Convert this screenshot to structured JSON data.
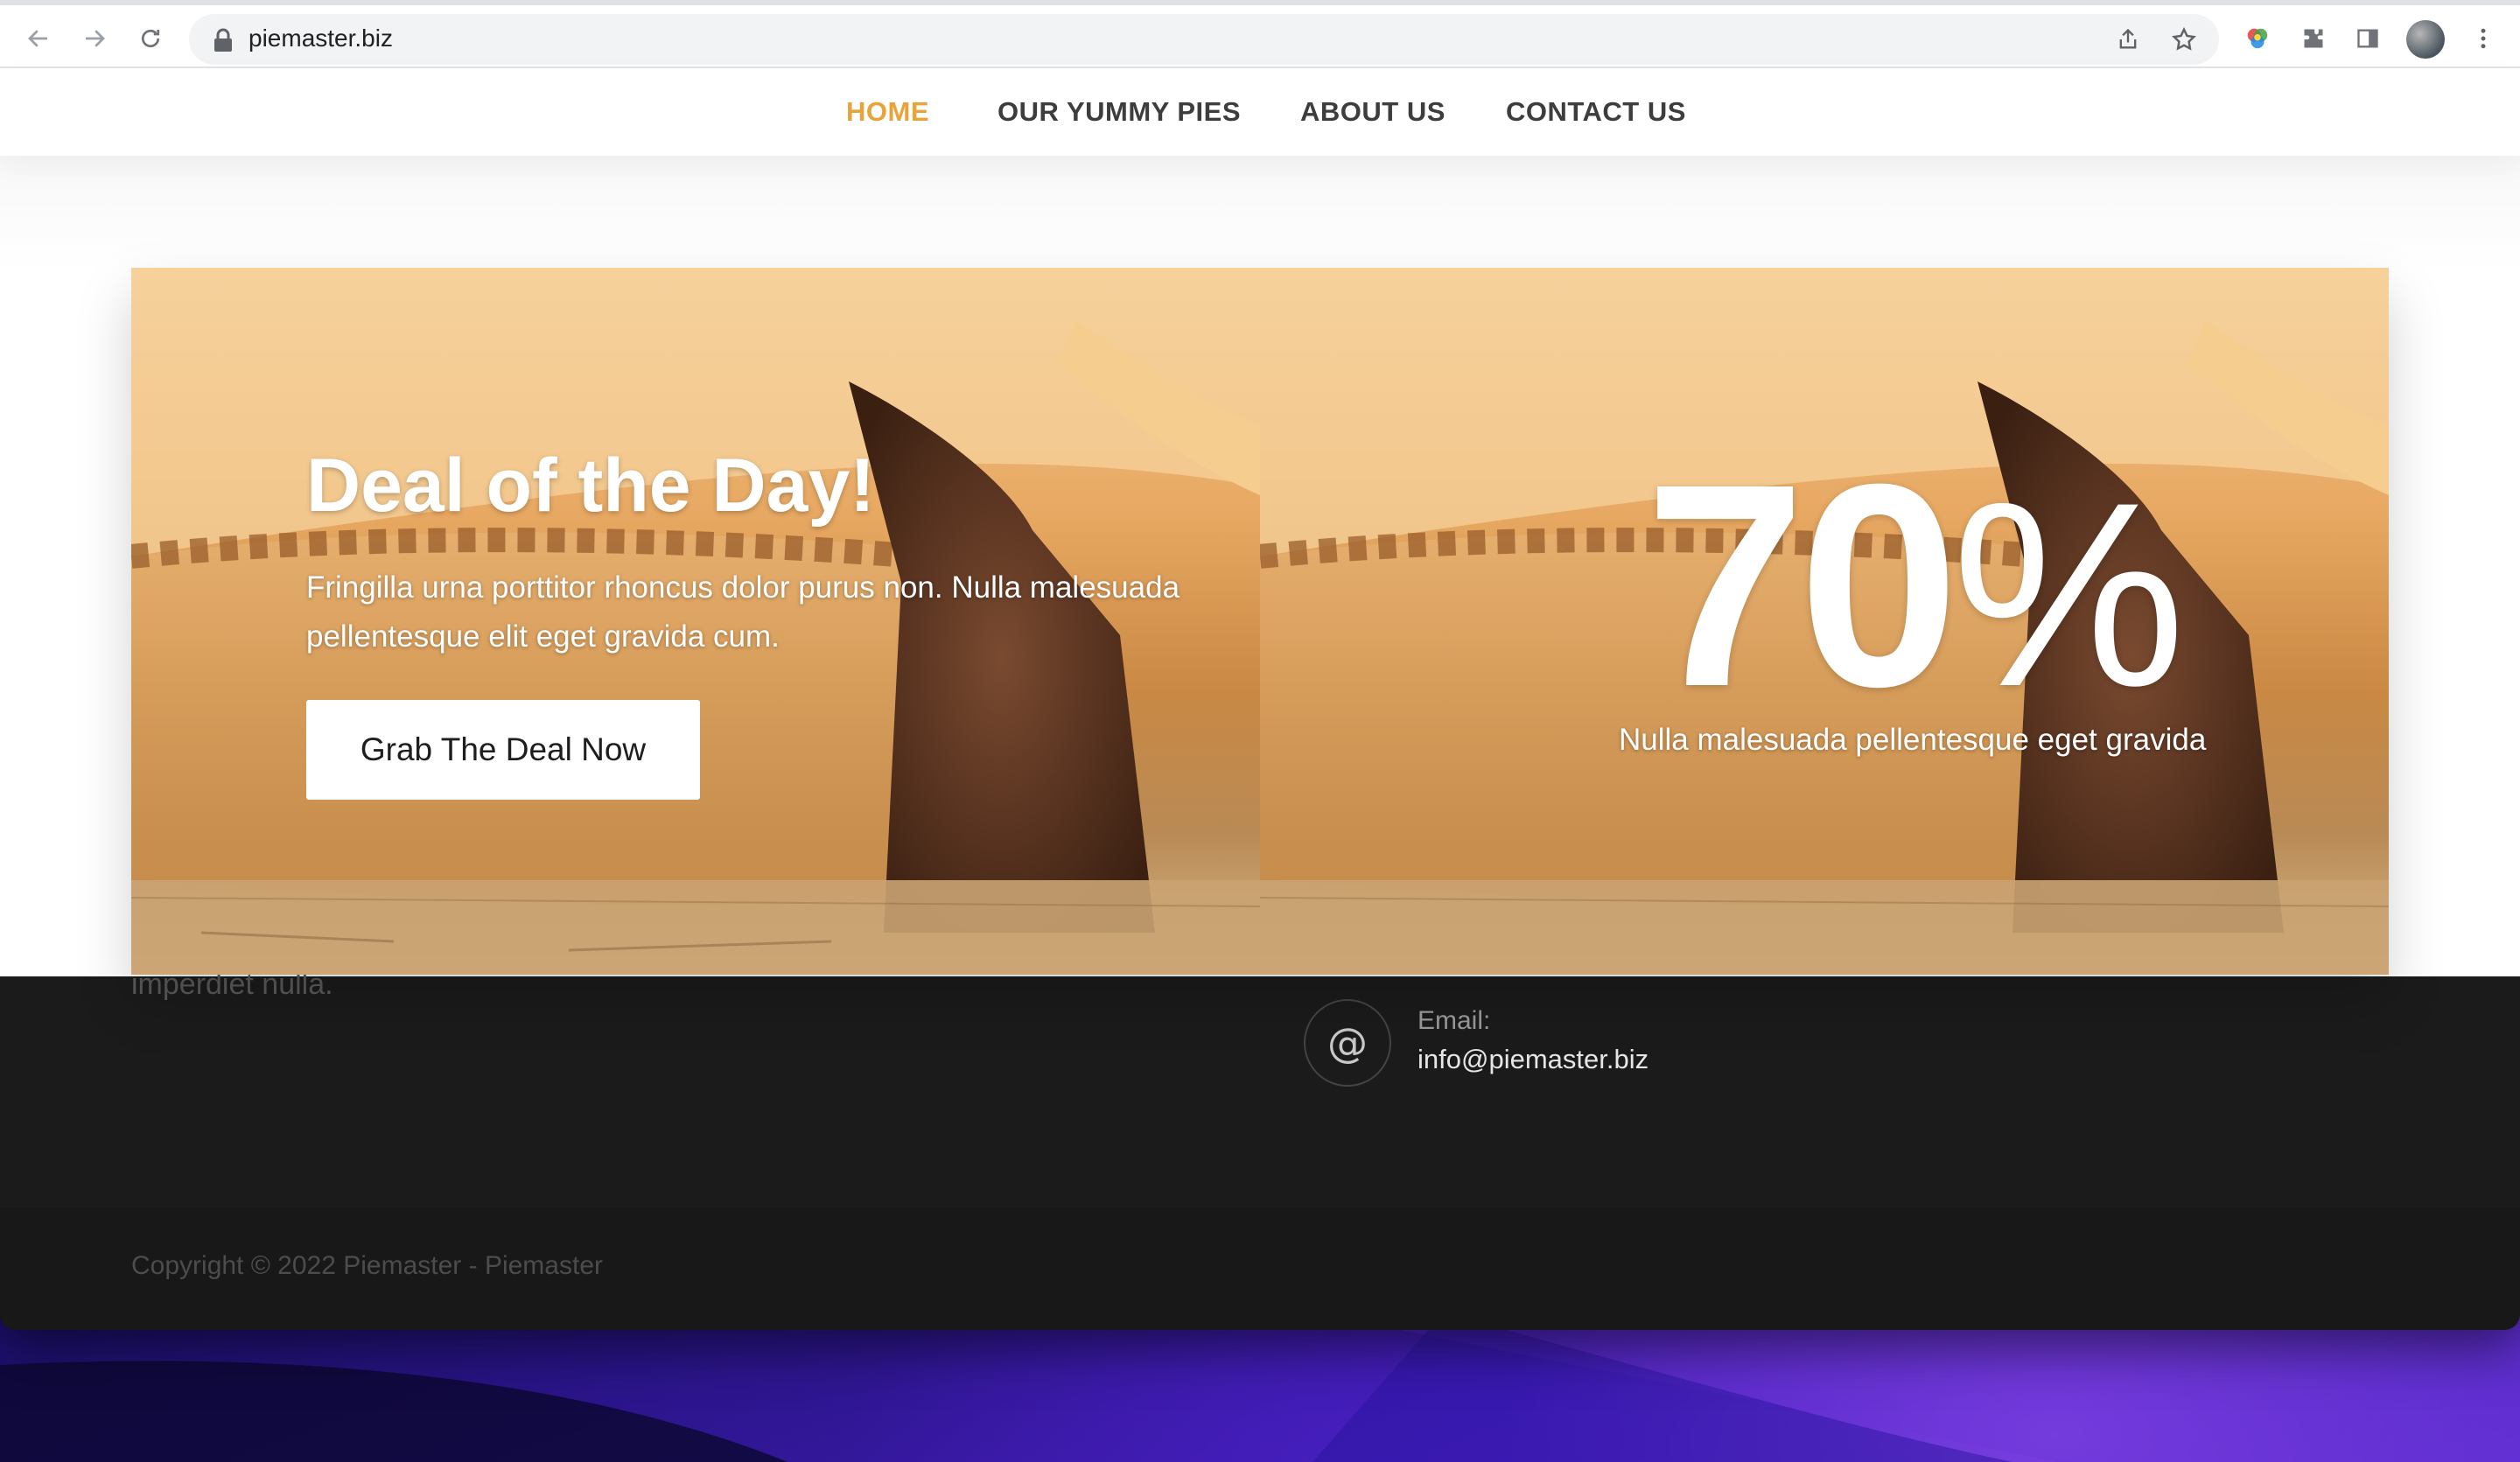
{
  "browser": {
    "url": "piemaster.biz",
    "icons": {
      "back": "arrow-left-icon",
      "forward": "arrow-right-icon",
      "reload": "reload-icon",
      "lock": "lock-icon",
      "share": "share-icon",
      "bookmark": "star-icon",
      "extension_color": "color-wheel-icon",
      "extensions": "puzzle-icon",
      "side_panel": "side-panel-icon",
      "profile": "avatar",
      "menu": "kebab-menu-icon"
    }
  },
  "nav": {
    "items": [
      {
        "label": "HOME",
        "active": true
      },
      {
        "label": "OUR YUMMY PIES",
        "active": false
      },
      {
        "label": "ABOUT US",
        "active": false
      },
      {
        "label": "CONTACT US",
        "active": false
      }
    ],
    "accent_color": "#e8a43a"
  },
  "hero": {
    "left": {
      "title": "Deal of the Day!",
      "text": "Fringilla urna porttitor rhoncus dolor purus non. Nulla malesuada pellentesque elit eget gravida cum.",
      "button_label": "Grab The Deal Now"
    },
    "right": {
      "big_number": "70",
      "big_suffix": "%",
      "subtitle": "Nulla malesuada pellentesque eget gravida"
    }
  },
  "footer": {
    "partial_text": "imperdiet nulla.",
    "email_label": "Email:",
    "email_value": "info@piemaster.biz",
    "email_icon": "at-sign-icon",
    "copyright": "Copyright © 2022 Piemaster -  Piemaster"
  }
}
